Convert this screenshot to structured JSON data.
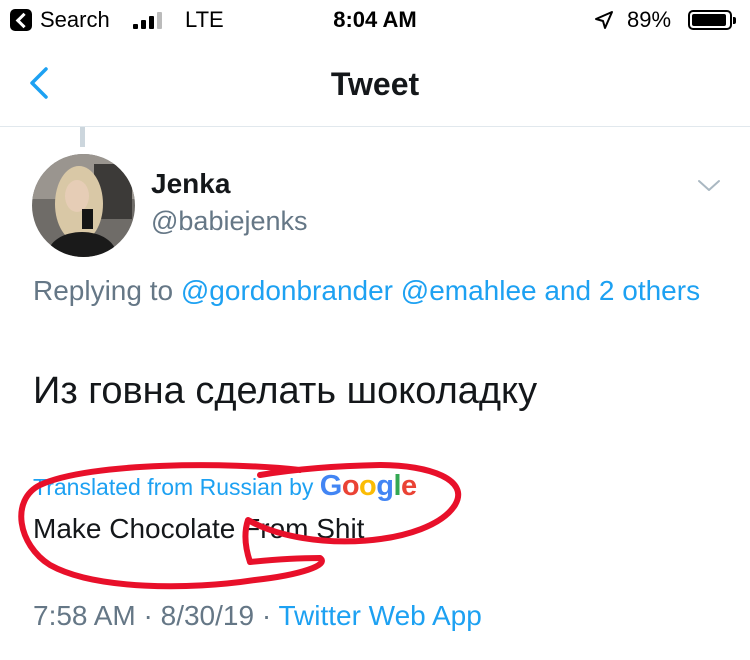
{
  "status_bar": {
    "back_app": "Search",
    "network": "LTE",
    "time": "8:04 AM",
    "battery": "89%",
    "battery_level": 0.89
  },
  "nav": {
    "title": "Tweet",
    "back_icon": "chevron-left-icon"
  },
  "tweet": {
    "author_name": "Jenka",
    "author_handle": "@babiejenks",
    "replying_prefix": "Replying to",
    "replying_users": [
      "@gordonbrander",
      "@emahlee"
    ],
    "replying_and": "and",
    "replying_others": "2 others",
    "text": "Из говна сделать шоколадку",
    "translated_label": "Translated from Russian by",
    "translator": "Google",
    "translation": "Make Chocolate From Shit",
    "time": "7:58 AM",
    "date": "8/30/19",
    "separator": "·",
    "source": "Twitter Web App"
  },
  "colors": {
    "accent": "#1da1f2",
    "secondary_text": "#657786",
    "scribble": "#e8102a"
  }
}
